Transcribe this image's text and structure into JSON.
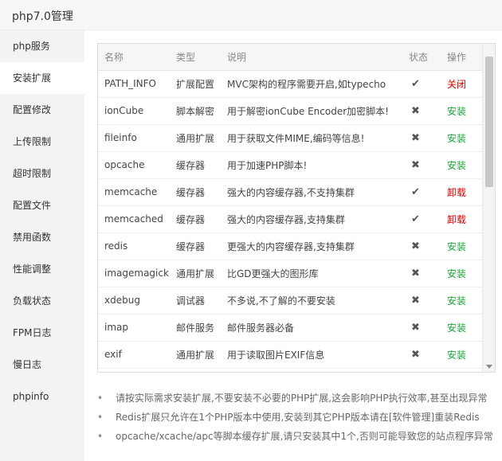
{
  "window": {
    "title": "php7.0管理"
  },
  "sidebar": {
    "items": [
      {
        "label": "php服务",
        "name": "php-service"
      },
      {
        "label": "安装扩展",
        "name": "install-extensions"
      },
      {
        "label": "配置修改",
        "name": "config-edit"
      },
      {
        "label": "上传限制",
        "name": "upload-limit"
      },
      {
        "label": "超时限制",
        "name": "timeout-limit"
      },
      {
        "label": "配置文件",
        "name": "config-file"
      },
      {
        "label": "禁用函数",
        "name": "disabled-functions"
      },
      {
        "label": "性能调整",
        "name": "performance-tuning"
      },
      {
        "label": "负载状态",
        "name": "load-status"
      },
      {
        "label": "FPM日志",
        "name": "fpm-log"
      },
      {
        "label": "慢日志",
        "name": "slow-log"
      },
      {
        "label": "phpinfo",
        "name": "phpinfo"
      }
    ],
    "active_index": 1
  },
  "table": {
    "headers": {
      "name": "名称",
      "type": "类型",
      "desc": "说明",
      "status": "状态",
      "op": "操作"
    },
    "rows": [
      {
        "name": "PATH_INFO",
        "type": "扩展配置",
        "desc": "MVC架构的程序需要开启,如typecho",
        "status": "check",
        "op": "关闭",
        "op_kind": "close"
      },
      {
        "name": "ionCube",
        "type": "脚本解密",
        "desc": "用于解密ionCube Encoder加密脚本!",
        "status": "cross",
        "op": "安装",
        "op_kind": "install"
      },
      {
        "name": "fileinfo",
        "type": "通用扩展",
        "desc": "用于获取文件MIME,编码等信息!",
        "status": "cross",
        "op": "安装",
        "op_kind": "install"
      },
      {
        "name": "opcache",
        "type": "缓存器",
        "desc": "用于加速PHP脚本!",
        "status": "cross",
        "op": "安装",
        "op_kind": "install"
      },
      {
        "name": "memcache",
        "type": "缓存器",
        "desc": "强大的内容缓存器,不支持集群",
        "status": "check",
        "op": "卸载",
        "op_kind": "uninstall"
      },
      {
        "name": "memcached",
        "type": "缓存器",
        "desc": "强大的内容缓存器,支持集群",
        "status": "check",
        "op": "卸载",
        "op_kind": "uninstall"
      },
      {
        "name": "redis",
        "type": "缓存器",
        "desc": "更强大的内容缓存器,支持集群",
        "status": "cross",
        "op": "安装",
        "op_kind": "install"
      },
      {
        "name": "imagemagick",
        "type": "通用扩展",
        "desc": "比GD更强大的图形库",
        "status": "cross",
        "op": "安装",
        "op_kind": "install"
      },
      {
        "name": "xdebug",
        "type": "调试器",
        "desc": "不多说,不了解的不要安装",
        "status": "cross",
        "op": "安装",
        "op_kind": "install"
      },
      {
        "name": "imap",
        "type": "邮件服务",
        "desc": "邮件服务器必备",
        "status": "cross",
        "op": "安装",
        "op_kind": "install"
      },
      {
        "name": "exif",
        "type": "通用扩展",
        "desc": "用于读取图片EXIF信息",
        "status": "cross",
        "op": "安装",
        "op_kind": "install"
      }
    ]
  },
  "notes": [
    "请按实际需求安装扩展,不要安装不必要的PHP扩展,这会影响PHP执行效率,甚至出现异常",
    "Redis扩展只允许在1个PHP版本中使用,安装到其它PHP版本请在[软件管理]重装Redis",
    "opcache/xcache/apc等脚本缓存扩展,请只安装其中1个,否则可能导致您的站点程序异常"
  ],
  "icons": {
    "check": "✔",
    "cross": "✖"
  },
  "colors": {
    "install": "#20a53a",
    "danger": "#dd0000",
    "sidebar_bg": "#f3f3f3"
  }
}
